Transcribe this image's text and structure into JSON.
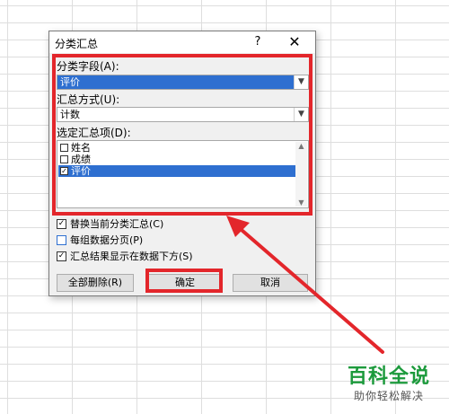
{
  "dialog": {
    "title": "分类汇总",
    "help": "?",
    "close": "✕"
  },
  "group_field": {
    "label": "分类字段(A):",
    "value": "评价"
  },
  "summary_method": {
    "label": "汇总方式(U):",
    "value": "计数"
  },
  "summary_items": {
    "label": "选定汇总项(D):",
    "items": [
      {
        "label": "姓名",
        "checked": false
      },
      {
        "label": "成绩",
        "checked": false
      },
      {
        "label": "评价",
        "checked": true
      }
    ]
  },
  "options": [
    {
      "label": "替换当前分类汇总(C)",
      "checked": true
    },
    {
      "label": "每组数据分页(P)",
      "checked": false
    },
    {
      "label": "汇总结果显示在数据下方(S)",
      "checked": true
    }
  ],
  "buttons": {
    "remove_all": "全部删除(R)",
    "ok": "确定",
    "cancel": "取消"
  },
  "watermark": {
    "title": "百科全说",
    "subtitle": "助你轻松解决"
  },
  "colors": {
    "highlight": "#e3262b",
    "selection": "#2e6fd0",
    "watermark": "#1c9a3c"
  }
}
